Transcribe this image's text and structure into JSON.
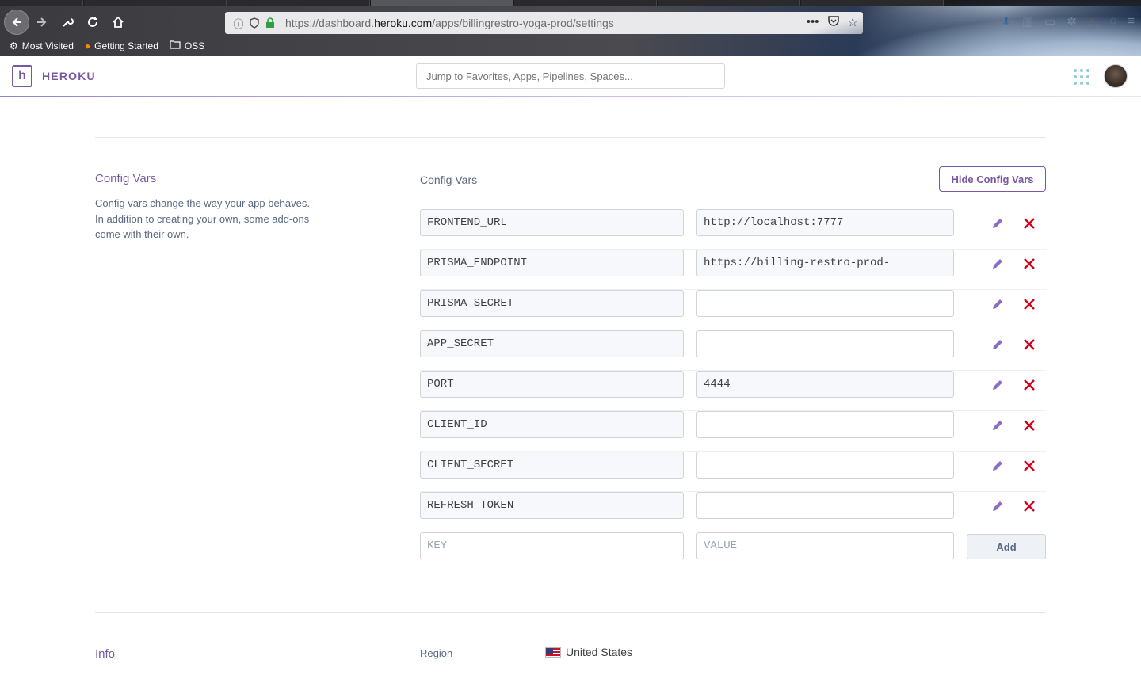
{
  "browser": {
    "url_prefix": "https://dashboard.",
    "url_domain": "heroku.com",
    "url_path": "/apps/billingrestro-yoga-prod/settings",
    "bookmarks": [
      "Most Visited",
      "Getting Started",
      "OSS"
    ]
  },
  "header": {
    "brand": "HEROKU",
    "search_placeholder": "Jump to Favorites, Apps, Pipelines, Spaces..."
  },
  "config_section": {
    "title": "Config Vars",
    "description": "Config vars change the way your app behaves. In addition to creating your own, some add-ons come with their own.",
    "heading": "Config Vars",
    "hide_button": "Hide Config Vars",
    "vars": [
      {
        "key": "FRONTEND_URL",
        "value": "http://localhost:7777"
      },
      {
        "key": "PRISMA_ENDPOINT",
        "value": "https://billing-restro-prod-"
      },
      {
        "key": "PRISMA_SECRET",
        "value": ""
      },
      {
        "key": "APP_SECRET",
        "value": ""
      },
      {
        "key": "PORT",
        "value": "4444"
      },
      {
        "key": "CLIENT_ID",
        "value": ""
      },
      {
        "key": "CLIENT_SECRET",
        "value": ""
      },
      {
        "key": "REFRESH_TOKEN",
        "value": ""
      }
    ],
    "new_key_placeholder": "KEY",
    "new_value_placeholder": "VALUE",
    "add_button": "Add"
  },
  "info_section": {
    "title": "Info",
    "region_label": "Region",
    "region_value": "United States"
  }
}
